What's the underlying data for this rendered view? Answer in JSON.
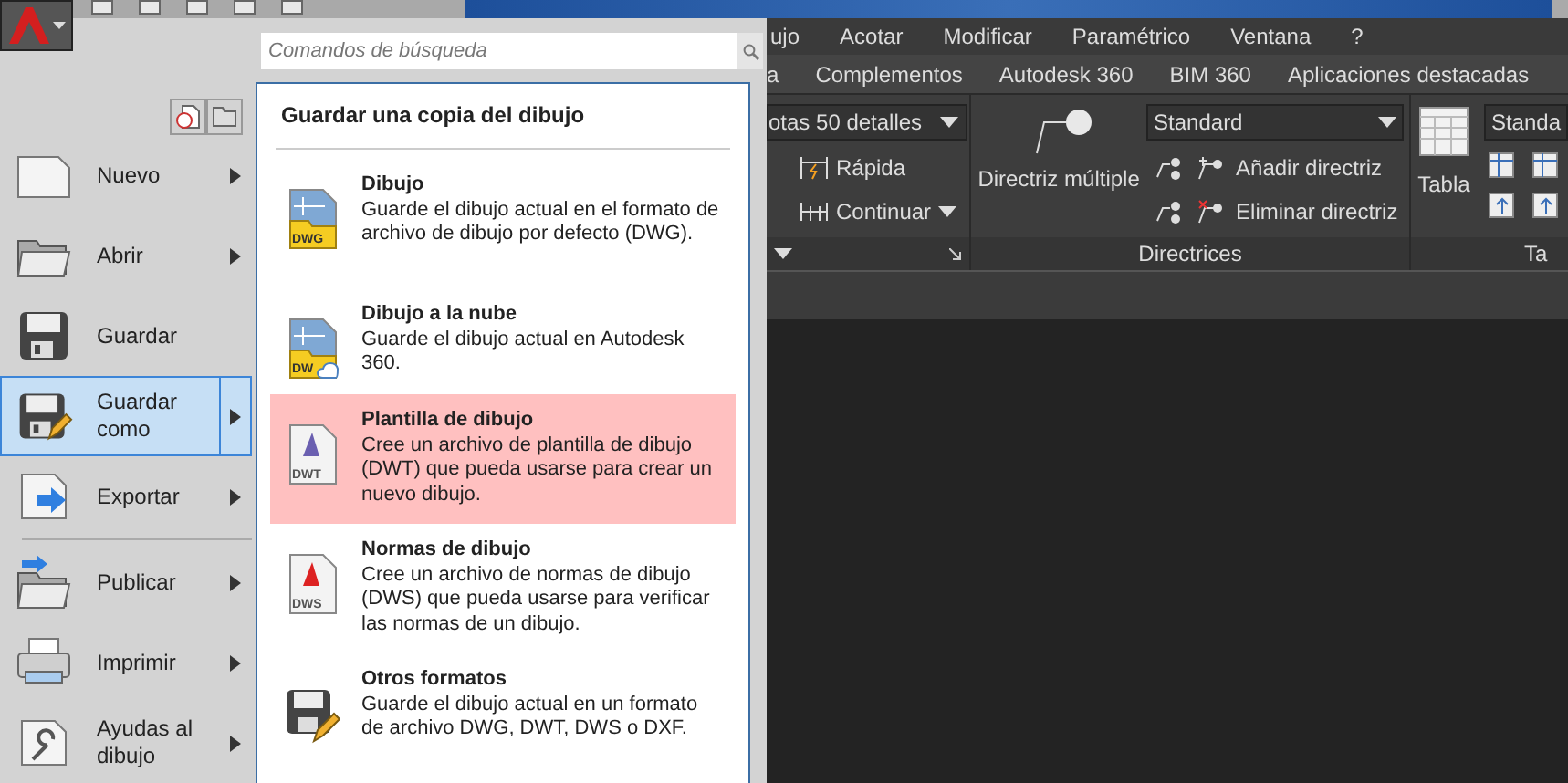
{
  "search": {
    "placeholder": "Comandos de búsqueda"
  },
  "menu_groups": [
    [
      {
        "label": "Nuevo",
        "selected": false,
        "submenu": true
      },
      {
        "label": "Abrir",
        "selected": false,
        "submenu": true
      },
      {
        "label": "Guardar",
        "selected": false,
        "submenu": false
      },
      {
        "label": "Guardar como",
        "selected": true,
        "submenu": true
      },
      {
        "label": "Exportar",
        "selected": false,
        "submenu": true
      }
    ],
    [
      {
        "label": "Publicar",
        "selected": false,
        "submenu": true
      },
      {
        "label": "Imprimir",
        "selected": false,
        "submenu": true
      },
      {
        "label": "Ayudas al dibujo",
        "selected": false,
        "submenu": true
      }
    ]
  ],
  "submenu": {
    "title": "Guardar una copia del dibujo",
    "options": [
      {
        "title": "Dibujo",
        "description": "Guarde el dibujo actual en el formato de archivo de dibujo por defecto (DWG).",
        "badge": "DWG",
        "selected": false
      },
      {
        "title": "Dibujo a la nube",
        "description": "Guarde el dibujo actual en Autodesk 360.",
        "badge": "DW",
        "selected": false
      },
      {
        "title": "Plantilla de dibujo",
        "description": "Cree un archivo de plantilla de dibujo (DWT) que pueda usarse para crear un nuevo dibujo.",
        "badge": "DWT",
        "selected": true
      },
      {
        "title": "Normas de dibujo",
        "description": "Cree un archivo de normas de dibujo (DWS) que pueda usarse para verificar las normas de un dibujo.",
        "badge": "DWS",
        "selected": false
      },
      {
        "title": "Otros formatos",
        "description": "Guarde el dibujo actual en un formato de archivo DWG, DWT, DWS o DXF.",
        "selected": false
      }
    ]
  },
  "menu_bar": [
    "ujo",
    "Acotar",
    "Modificar",
    "Paramétrico",
    "Ventana",
    "?"
  ],
  "ribbon_tabs": [
    "a",
    "Complementos",
    "Autodesk 360",
    "BIM 360",
    "Aplicaciones destacadas"
  ],
  "ribbon": {
    "dim_style": "otas 50 detalles",
    "quick": "Rápida",
    "continue": "Continuar",
    "multileader": "Directriz múltiple",
    "leader_style": "Standard",
    "add_leader": "Añadir directriz",
    "remove_leader": "Eliminar directriz",
    "leaders_panel": "Directrices",
    "table": "Tabla",
    "table_style": "Standa",
    "table_panel": "Ta"
  }
}
